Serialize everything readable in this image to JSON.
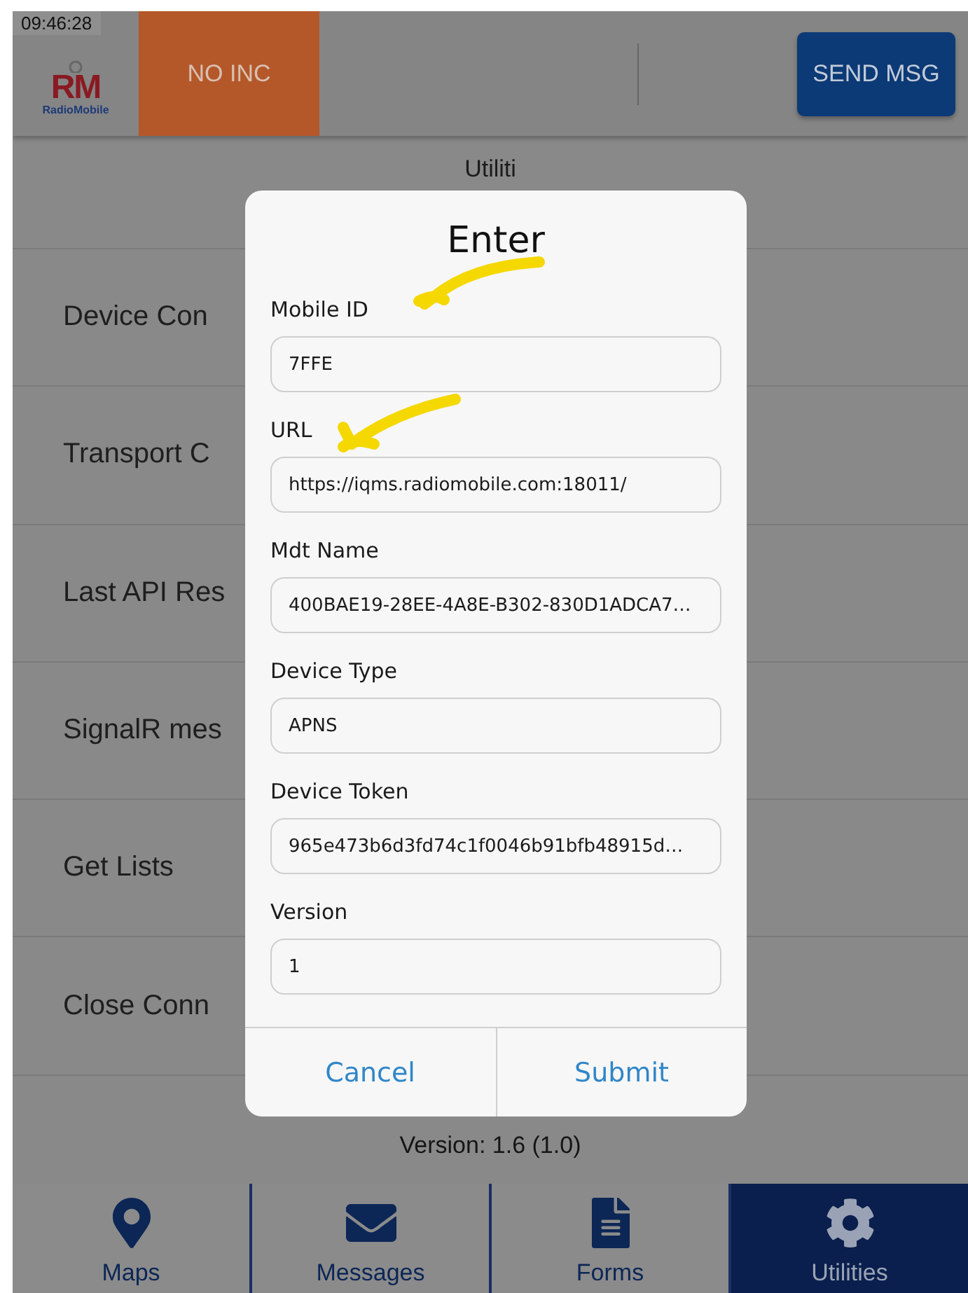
{
  "status_time": "09:46:28",
  "header": {
    "logo": {
      "letters": "RM",
      "name": "RadioMobile"
    },
    "incident": "NO INC",
    "send_button": "SEND MSG"
  },
  "page_title": "Utiliti",
  "menu_items": [
    "Device Con",
    "Transport C",
    "Last API Res",
    "SignalR mes",
    "Get Lists",
    "Close Conn"
  ],
  "version_text": "Version: 1.6 (1.0)",
  "dialog": {
    "title": "Enter",
    "fields": [
      {
        "label": "Mobile ID",
        "value": "7FFE",
        "annotated": true
      },
      {
        "label": "URL",
        "value": "https://iqms.radiomobile.com:18011/",
        "annotated": true
      },
      {
        "label": "Mdt Name",
        "value": "400BAE19-28EE-4A8E-B302-830D1ADCA7…",
        "annotated": false
      },
      {
        "label": "Device Type",
        "value": "APNS",
        "annotated": false
      },
      {
        "label": "Device Token",
        "value": "965e473b6d3fd74c1f0046b91bfb48915d…",
        "annotated": false
      },
      {
        "label": "Version",
        "value": "1",
        "annotated": false
      }
    ],
    "buttons": [
      "Cancel",
      "Submit"
    ]
  },
  "tabs": [
    {
      "label": "Maps",
      "kind": "map",
      "selected": false
    },
    {
      "label": "Messages",
      "kind": "mail",
      "selected": false
    },
    {
      "label": "Forms",
      "kind": "form",
      "selected": false
    },
    {
      "label": "Utilities",
      "kind": "gear",
      "selected": true
    }
  ]
}
